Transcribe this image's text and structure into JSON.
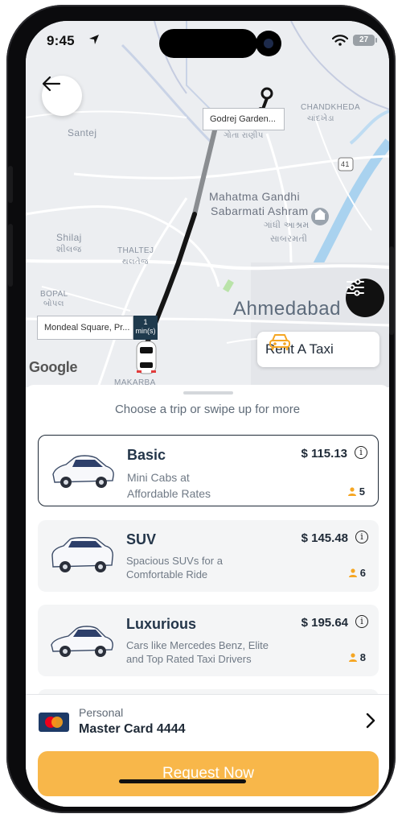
{
  "status_bar": {
    "time": "9:45",
    "battery": "27"
  },
  "map": {
    "pickup_label": "Godrej Garden...",
    "dropoff_label": "Mondeal Square, Pr...",
    "eta_value": "1",
    "eta_unit": "min(s)",
    "place_labels": {
      "santej": "Santej",
      "chandkheda": "CHANDKHEDA",
      "chandkheda_gu": "ચાંદખેડા",
      "ranip_gu": "ગોતા  રાણીપ",
      "ashram": "Mahatma Gandhi",
      "ashram2": "Sabarmati Ashram",
      "ashram_gu": "ગાંધી આશ્રમ",
      "ashram_gu2": "સાબરમતી",
      "shilaj": "Shilaj",
      "shilaj_gu": "શીલજ",
      "thaltej": "THALTEJ",
      "thaltej_gu": "થલતેજ",
      "bopal": "BOPAL",
      "bopal_gu": "બોપલ",
      "city": "Ahmedabad",
      "makarba": "MAKARBA",
      "route_badge": "41"
    },
    "google_logo": "Google",
    "rent_button": "Rent A Taxi"
  },
  "sheet": {
    "hint": "Choose a trip or swipe up for more",
    "options": [
      {
        "name": "Basic",
        "description": "Mini Cabs at Affordable Rates",
        "price": "$ 115.13",
        "seats": "5",
        "selected": true
      },
      {
        "name": "SUV",
        "description": "Spacious SUVs for a Comfortable Ride",
        "price": "$ 145.48",
        "seats": "6",
        "selected": false
      },
      {
        "name": "Luxurious",
        "description": "Cars like Mercedes Benz, Elite and Top Rated Taxi Drivers",
        "price": "$ 195.64",
        "seats": "8",
        "selected": false
      }
    ],
    "info_glyph": "i"
  },
  "payment": {
    "type": "Personal",
    "method": "Master Card 4444"
  },
  "request_button": "Request Now",
  "colors": {
    "accent": "#f8b74a",
    "route": "#111111",
    "water": "#9fc9ea",
    "text_primary": "#1f2a37"
  }
}
